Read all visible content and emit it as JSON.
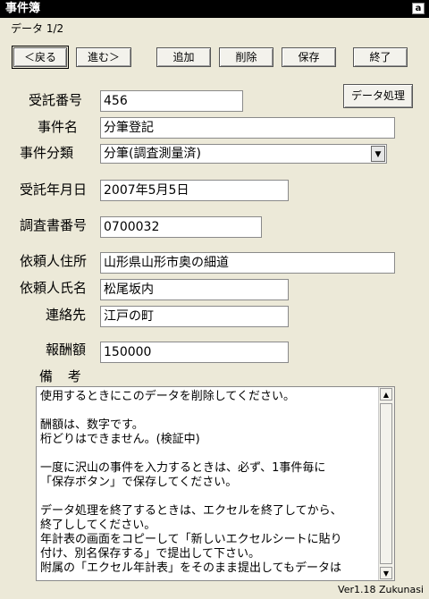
{
  "window": {
    "title": "事件簿",
    "corner_button": "a"
  },
  "counter": "データ 1/2",
  "toolbar": {
    "back": "＜戻る",
    "forward": "進む＞",
    "add": "追加",
    "delete": "削除",
    "save": "保存",
    "exit": "終了"
  },
  "data_processing_button": "データ処理",
  "fields": {
    "uketaku_no": {
      "label": "受託番号",
      "value": "456"
    },
    "jiken_name": {
      "label": "事件名",
      "value": "分筆登記"
    },
    "jiken_category": {
      "label": "事件分類",
      "value": "分筆(調査測量済)"
    },
    "uketaku_date": {
      "label": "受託年月日",
      "value": "2007年5月5日"
    },
    "chosa_no": {
      "label": "調査書番号",
      "value": "0700032"
    },
    "client_address": {
      "label": "依頼人住所",
      "value": "山形県山形市奥の細道"
    },
    "client_name": {
      "label": "依頼人氏名",
      "value": "松尾坂内"
    },
    "contact": {
      "label": "連絡先",
      "value": "江戸の町"
    },
    "fee": {
      "label": "報酬額",
      "value": "150000"
    }
  },
  "remarks": {
    "label": "備 考",
    "text": "使用するときにこのデータを削除してください。\n\n酬額は、数字です。\n桁どりはできません。(検証中)\n\n一度に沢山の事件を入力するときは、必ず、1事件毎に\n「保存ボタン」で保存してください。\n\nデータ処理を終了するときは、エクセルを終了してから、\n終了ししてください。\n年計表の画面をコピーして「新しいエクセルシートに貼り\n付け、別名保存する」で提出して下さい。\n附属の「エクセル年計表」をそのまま提出してもデータは"
  },
  "version": "Ver1.18 Zukunasi"
}
